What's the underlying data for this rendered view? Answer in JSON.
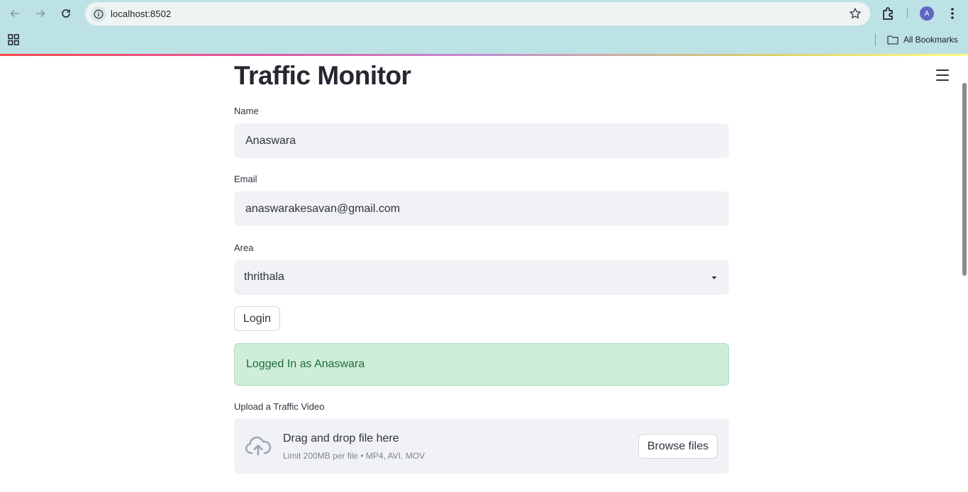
{
  "browser": {
    "url": "localhost:8502",
    "profile_initial": "A",
    "bookmarks_label": "All Bookmarks"
  },
  "app": {
    "title": "Traffic Monitor",
    "name": {
      "label": "Name",
      "value": "Anaswara"
    },
    "email": {
      "label": "Email",
      "value": "anaswarakesavan@gmail.com"
    },
    "area": {
      "label": "Area",
      "value": "thrithala"
    },
    "login_label": "Login",
    "alert_message": "Logged In as Anaswara",
    "upload": {
      "label": "Upload a Traffic Video",
      "drop_text": "Drag and drop file here",
      "limit_text": "Limit 200MB per file • MP4, AVI, MOV",
      "browse_label": "Browse files"
    }
  },
  "colors": {
    "chrome": "#bde2e6",
    "input_bg": "#f0f2f6",
    "success_bg": "#cfeed9",
    "success_text": "#1d6b38"
  }
}
